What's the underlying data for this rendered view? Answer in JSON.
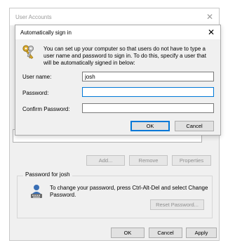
{
  "background_window": {
    "title": "User Accounts",
    "buttons": {
      "add": "Add...",
      "remove": "Remove",
      "properties": "Properties"
    },
    "password_group": {
      "label": "Password for josh",
      "description": "To change your password, press Ctrl-Alt-Del and select Change Password.",
      "reset_button": "Reset Password..."
    },
    "footer": {
      "ok": "OK",
      "cancel": "Cancel",
      "apply": "Apply"
    }
  },
  "dialog": {
    "title": "Automatically sign in",
    "description": "You can set up your computer so that users do not have to type a user name and password to sign in. To do this, specify a user that will be automatically signed in below:",
    "fields": {
      "user_name": {
        "label": "User name:",
        "value": "josh"
      },
      "password": {
        "label": "Password:",
        "value": ""
      },
      "confirm_password": {
        "label": "Confirm Password:",
        "value": ""
      }
    },
    "ok": "OK",
    "cancel": "Cancel"
  },
  "icons": {
    "dialog_icon": "keys-icon",
    "password_icon": "user-keyboard-icon",
    "close": "close-icon"
  },
  "colors": {
    "accent": "#0078d7",
    "window_bg": "#f0f0f0"
  }
}
